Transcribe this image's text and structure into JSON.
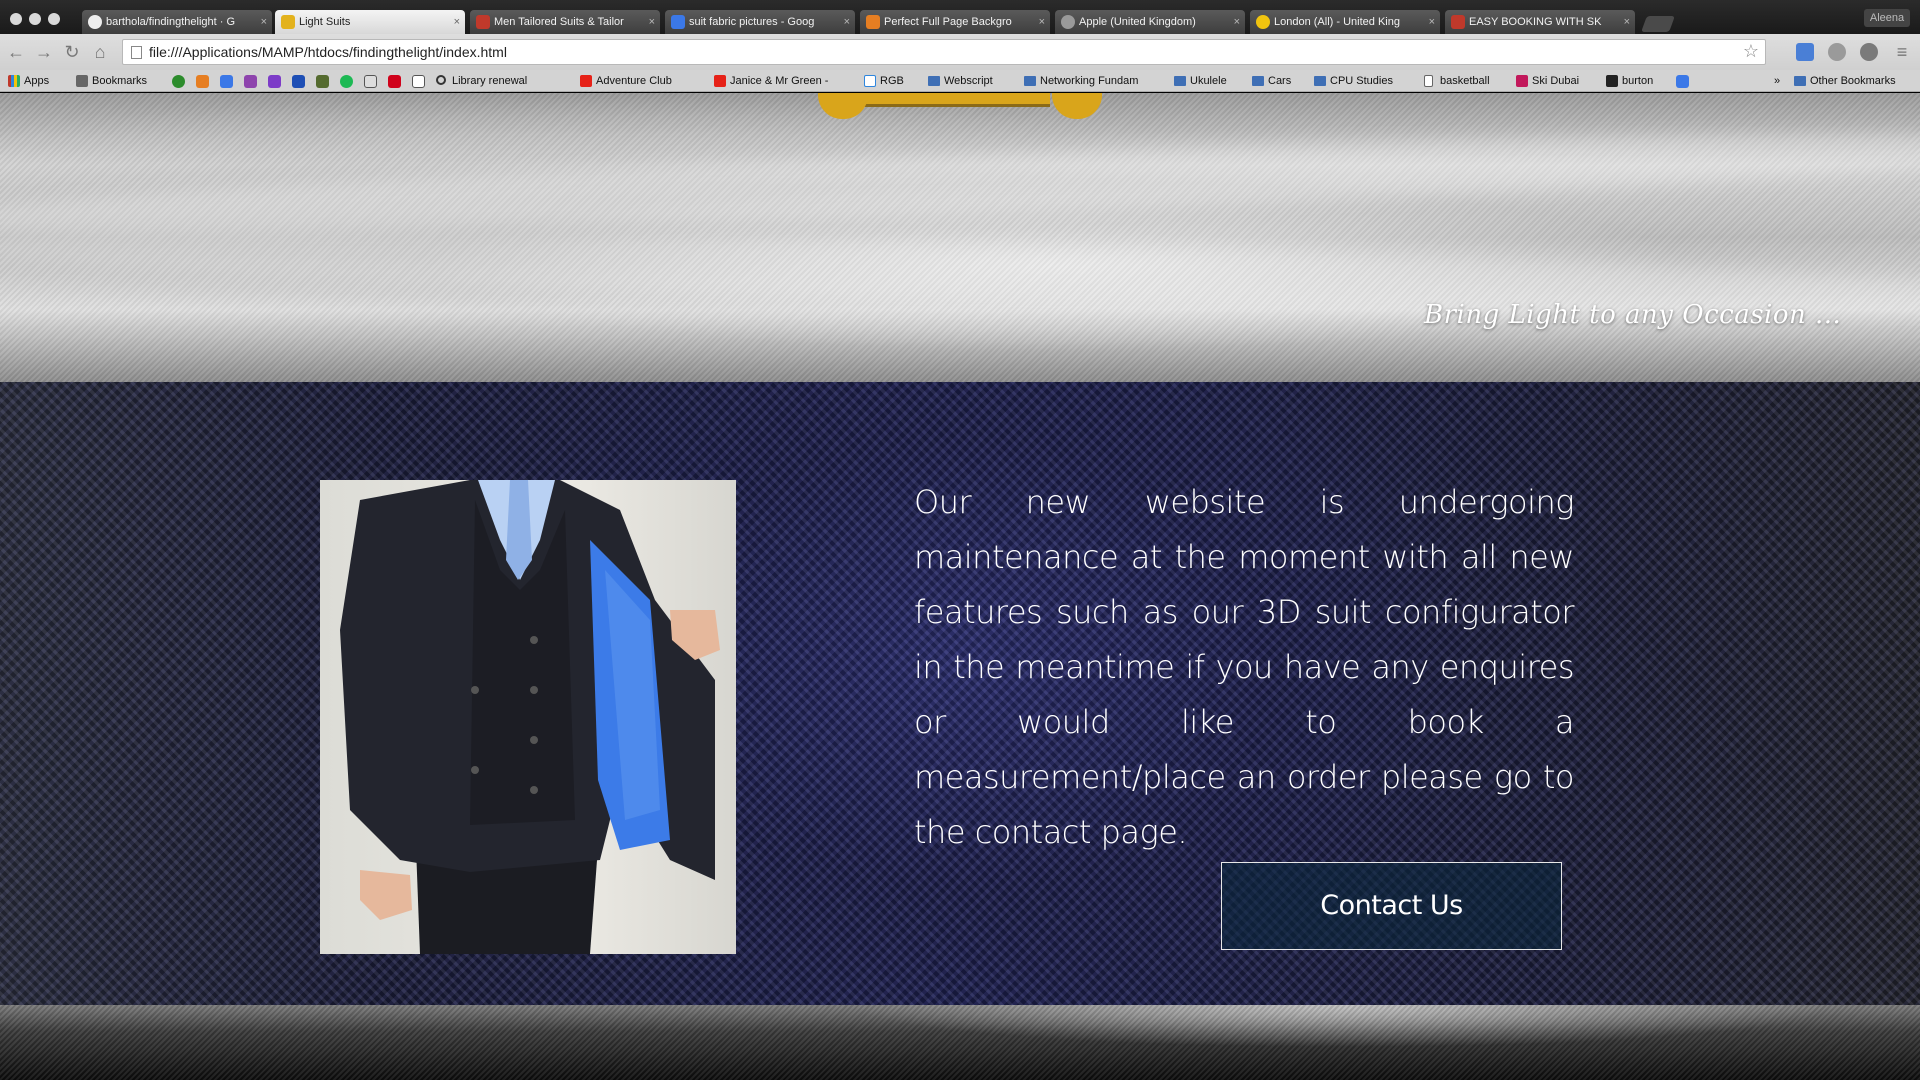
{
  "window": {
    "profile_name": "Aleena"
  },
  "tabs": [
    {
      "title": "barthola/findingthelight · G",
      "favicon_color": "#1a1a1a"
    },
    {
      "title": "Light Suits",
      "favicon_color": "#e3b21d"
    },
    {
      "title": "Men Tailored Suits & Tailor",
      "favicon_color": "#c0392b"
    },
    {
      "title": "suit fabric pictures - Goog",
      "favicon_color": "#3b78e7"
    },
    {
      "title": "Perfect Full Page Backgro",
      "favicon_color": "#e67e22"
    },
    {
      "title": "Apple (United Kingdom)",
      "favicon_color": "#9a9a9a"
    },
    {
      "title": "London (All) - United King",
      "favicon_color": "#f1c40f"
    },
    {
      "title": "EASY BOOKING WITH SK",
      "favicon_color": "#c0392b"
    }
  ],
  "toolbar": {
    "url": "file:///Applications/MAMP/htdocs/findingthelight/index.html"
  },
  "bookmarks": {
    "apps": "Apps",
    "bookmarks": "Bookmarks",
    "library_renewal": "Library renewal",
    "adventure_club": "Adventure Club",
    "janice": "Janice & Mr Green -",
    "rgb": "RGB",
    "webscript": "Webscript",
    "networking": "Networking Fundam",
    "ukulele": "Ukulele",
    "cars": "Cars",
    "cpu_studies": "CPU Studies",
    "basketball": "basketball",
    "ski_dubai": "Ski Dubai",
    "burton": "burton",
    "other": "Other Bookmarks"
  },
  "page": {
    "tagline": "Bring Light to any Occasion ...",
    "message": "Our new website is undergoing maintenance at the moment with all new features such as our 3D suit configurator in the meantime if you have any enquires or would like to book a measurement/place an order please go to the contact page.",
    "contact_button": "Contact Us",
    "accent_gold": "#d9a51b",
    "lining_blue": "#3c7be8"
  }
}
